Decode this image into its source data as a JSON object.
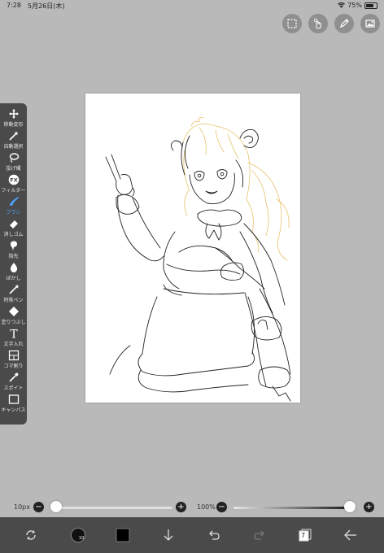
{
  "status_bar": {
    "time": "7:28",
    "date": "5月26日(木)",
    "battery": "75%"
  },
  "top_toolbar": {
    "icons": [
      "selection-icon",
      "gesture-hand-icon",
      "pen-edit-icon",
      "gallery-image-icon"
    ]
  },
  "tools": [
    {
      "label": "移動変形",
      "icon": "move-transform-icon",
      "active": false
    },
    {
      "label": "自動選択",
      "icon": "magic-wand-icon",
      "active": false
    },
    {
      "label": "投げ縄",
      "icon": "lasso-icon",
      "active": false
    },
    {
      "label": "フィルター",
      "icon": "fx-filter-icon",
      "active": false
    },
    {
      "label": "ブラシ",
      "icon": "brush-icon",
      "active": true
    },
    {
      "label": "消しゴム",
      "icon": "eraser-icon",
      "active": false
    },
    {
      "label": "指先",
      "icon": "finger-smudge-icon",
      "active": false
    },
    {
      "label": "ぼかし",
      "icon": "blur-drop-icon",
      "active": false
    },
    {
      "label": "特殊ペン",
      "icon": "special-pen-icon",
      "active": false
    },
    {
      "label": "塗りつぶし",
      "icon": "fill-bucket-icon",
      "active": false
    },
    {
      "label": "文字入れ",
      "icon": "text-icon",
      "active": false
    },
    {
      "label": "コマ割り",
      "icon": "frame-divider-icon",
      "active": false
    },
    {
      "label": "スポイト",
      "icon": "eyedropper-icon",
      "active": false
    },
    {
      "label": "キャンバス",
      "icon": "canvas-icon",
      "active": false
    }
  ],
  "brush_size": {
    "label": "10px",
    "minus": "−",
    "plus": "+",
    "value_fraction": 0.0
  },
  "opacity": {
    "label": "100%",
    "minus": "−",
    "plus": "+",
    "value_fraction": 1.0
  },
  "bottom_bar": {
    "brush_size_badge": "10",
    "layer_count": "7",
    "icons": [
      "transform-icon",
      "brush-preview-icon",
      "color-swatch-icon",
      "download-arrow-icon",
      "undo-icon",
      "redo-icon",
      "layers-icon",
      "back-arrow-icon"
    ]
  },
  "colors": {
    "background": "#b9b9b9",
    "panel": "#4a4a4a",
    "accent": "#4aa3ff",
    "sketch_line": "#222222",
    "sketch_yellow": "#e6c36a"
  }
}
